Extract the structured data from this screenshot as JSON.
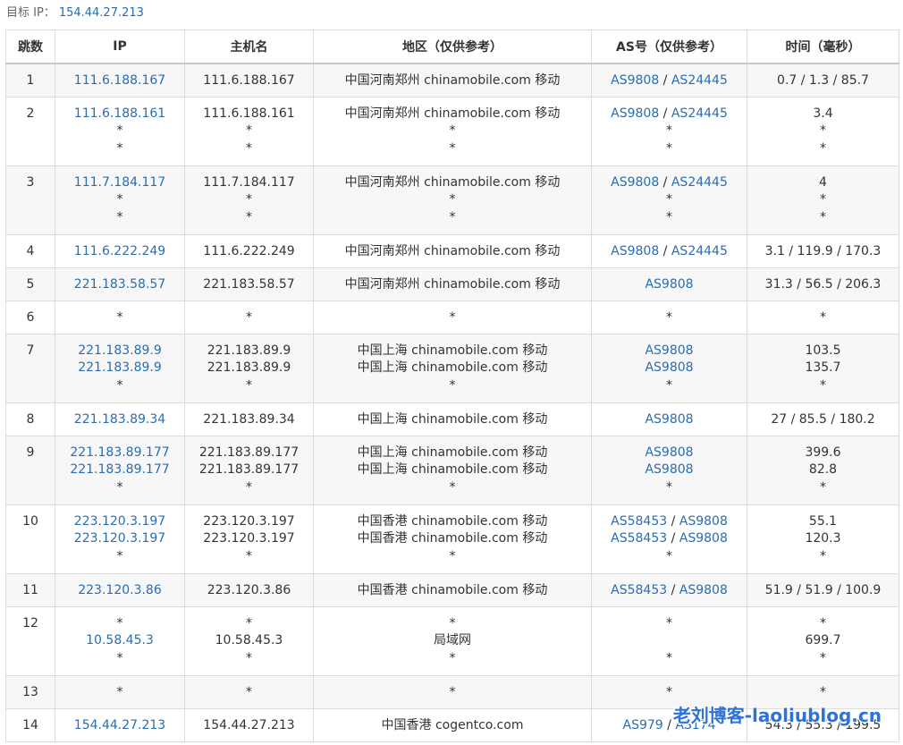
{
  "target": {
    "label": "目标 IP：",
    "ip": "154.44.27.213"
  },
  "columns": [
    "跳数",
    "IP",
    "主机名",
    "地区（仅供参考）",
    "AS号（仅供参考）",
    "时间（毫秒）"
  ],
  "rows": [
    {
      "hop": "1",
      "lines": [
        {
          "ip": "111.6.188.167",
          "host": "111.6.188.167",
          "region": "中国河南郑州 chinamobile.com 移动",
          "as": [
            "AS9808",
            "AS24445"
          ],
          "time": "0.7 / 1.3 / 85.7"
        }
      ]
    },
    {
      "hop": "2",
      "lines": [
        {
          "ip": "111.6.188.161",
          "host": "111.6.188.161",
          "region": "中国河南郑州 chinamobile.com 移动",
          "as": [
            "AS9808",
            "AS24445"
          ],
          "time": "3.4"
        },
        {
          "ip": "*",
          "host": "*",
          "region": "*",
          "as": [
            "*"
          ],
          "time": "*"
        },
        {
          "ip": "*",
          "host": "*",
          "region": "*",
          "as": [
            "*"
          ],
          "time": "*"
        }
      ]
    },
    {
      "hop": "3",
      "lines": [
        {
          "ip": "111.7.184.117",
          "host": "111.7.184.117",
          "region": "中国河南郑州 chinamobile.com 移动",
          "as": [
            "AS9808",
            "AS24445"
          ],
          "time": "4"
        },
        {
          "ip": "*",
          "host": "*",
          "region": "*",
          "as": [
            "*"
          ],
          "time": "*"
        },
        {
          "ip": "*",
          "host": "*",
          "region": "*",
          "as": [
            "*"
          ],
          "time": "*"
        }
      ]
    },
    {
      "hop": "4",
      "lines": [
        {
          "ip": "111.6.222.249",
          "host": "111.6.222.249",
          "region": "中国河南郑州 chinamobile.com 移动",
          "as": [
            "AS9808",
            "AS24445"
          ],
          "time": "3.1 / 119.9 / 170.3"
        }
      ]
    },
    {
      "hop": "5",
      "lines": [
        {
          "ip": "221.183.58.57",
          "host": "221.183.58.57",
          "region": "中国河南郑州 chinamobile.com 移动",
          "as": [
            "AS9808"
          ],
          "time": "31.3 / 56.5 / 206.3"
        }
      ]
    },
    {
      "hop": "6",
      "lines": [
        {
          "ip": "*",
          "host": "*",
          "region": "*",
          "as": [
            "*"
          ],
          "time": "*"
        }
      ]
    },
    {
      "hop": "7",
      "lines": [
        {
          "ip": "221.183.89.9",
          "host": "221.183.89.9",
          "region": "中国上海 chinamobile.com 移动",
          "as": [
            "AS9808"
          ],
          "time": "103.5"
        },
        {
          "ip": "221.183.89.9",
          "host": "221.183.89.9",
          "region": "中国上海 chinamobile.com 移动",
          "as": [
            "AS9808"
          ],
          "time": "135.7"
        },
        {
          "ip": "*",
          "host": "*",
          "region": "*",
          "as": [
            "*"
          ],
          "time": "*"
        }
      ]
    },
    {
      "hop": "8",
      "lines": [
        {
          "ip": "221.183.89.34",
          "host": "221.183.89.34",
          "region": "中国上海 chinamobile.com 移动",
          "as": [
            "AS9808"
          ],
          "time": "27 / 85.5 / 180.2"
        }
      ]
    },
    {
      "hop": "9",
      "lines": [
        {
          "ip": "221.183.89.177",
          "host": "221.183.89.177",
          "region": "中国上海 chinamobile.com 移动",
          "as": [
            "AS9808"
          ],
          "time": "399.6"
        },
        {
          "ip": "221.183.89.177",
          "host": "221.183.89.177",
          "region": "中国上海 chinamobile.com 移动",
          "as": [
            "AS9808"
          ],
          "time": "82.8"
        },
        {
          "ip": "*",
          "host": "*",
          "region": "*",
          "as": [
            "*"
          ],
          "time": "*"
        }
      ]
    },
    {
      "hop": "10",
      "lines": [
        {
          "ip": "223.120.3.197",
          "host": "223.120.3.197",
          "region": "中国香港 chinamobile.com 移动",
          "as": [
            "AS58453",
            "AS9808"
          ],
          "time": "55.1"
        },
        {
          "ip": "223.120.3.197",
          "host": "223.120.3.197",
          "region": "中国香港 chinamobile.com 移动",
          "as": [
            "AS58453",
            "AS9808"
          ],
          "time": "120.3"
        },
        {
          "ip": "*",
          "host": "*",
          "region": "*",
          "as": [
            "*"
          ],
          "time": "*"
        }
      ]
    },
    {
      "hop": "11",
      "lines": [
        {
          "ip": "223.120.3.86",
          "host": "223.120.3.86",
          "region": "中国香港 chinamobile.com 移动",
          "as": [
            "AS58453",
            "AS9808"
          ],
          "time": "51.9 / 51.9 / 100.9"
        }
      ]
    },
    {
      "hop": "12",
      "lines": [
        {
          "ip": "*",
          "host": "*",
          "region": "*",
          "as": [
            "*"
          ],
          "time": "*"
        },
        {
          "ip": "10.58.45.3",
          "host": "10.58.45.3",
          "region": "局域网",
          "as": [
            ""
          ],
          "time": "699.7"
        },
        {
          "ip": "*",
          "host": "*",
          "region": "*",
          "as": [
            "*"
          ],
          "time": "*"
        }
      ]
    },
    {
      "hop": "13",
      "lines": [
        {
          "ip": "*",
          "host": "*",
          "region": "*",
          "as": [
            "*"
          ],
          "time": "*"
        }
      ]
    },
    {
      "hop": "14",
      "lines": [
        {
          "ip": "154.44.27.213",
          "host": "154.44.27.213",
          "region": "中国香港 cogentco.com",
          "as": [
            "AS979",
            "AS174"
          ],
          "time": "54.3 / 55.3 / 199.5"
        }
      ]
    }
  ],
  "watermark": "老刘博客-laoliublog.cn",
  "colors": {
    "link": "#2a6db1",
    "text": "#333333",
    "stripe": "#f7f7f7",
    "border": "#dcdcdc",
    "watermark": "#2c72d8"
  }
}
